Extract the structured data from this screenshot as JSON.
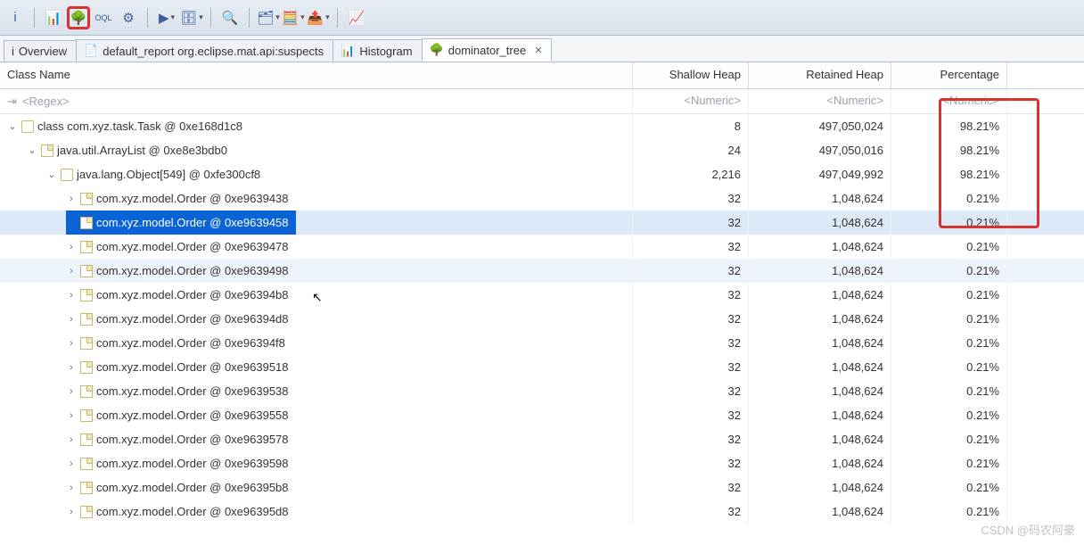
{
  "toolbar": {
    "items": [
      {
        "name": "info-icon",
        "glyph": "i",
        "drop": false
      },
      {
        "name": "sep"
      },
      {
        "name": "histogram-icon",
        "glyph": "📊",
        "drop": false
      },
      {
        "name": "dominator-tree-icon",
        "glyph": "🌳",
        "drop": false,
        "highlight": true
      },
      {
        "name": "oql-icon",
        "glyph": "OQL",
        "drop": false,
        "small": true
      },
      {
        "name": "gear-icon",
        "glyph": "⚙",
        "drop": false
      },
      {
        "name": "sep"
      },
      {
        "name": "run-icon",
        "glyph": "▶",
        "drop": true
      },
      {
        "name": "db-icon",
        "glyph": "🗄",
        "drop": true
      },
      {
        "name": "sep"
      },
      {
        "name": "search-icon",
        "glyph": "🔍",
        "drop": false
      },
      {
        "name": "sep"
      },
      {
        "name": "group-icon",
        "glyph": "🗂",
        "drop": true
      },
      {
        "name": "calc-icon",
        "glyph": "🧮",
        "drop": true
      },
      {
        "name": "export-icon",
        "glyph": "📤",
        "drop": true
      },
      {
        "name": "sep"
      },
      {
        "name": "chart-icon",
        "glyph": "📈",
        "drop": false
      }
    ]
  },
  "tabs": [
    {
      "icon": "i",
      "label": "Overview",
      "name": "tab-overview"
    },
    {
      "icon": "📄",
      "label": "default_report  org.eclipse.mat.api:suspects",
      "name": "tab-suspects"
    },
    {
      "icon": "📊",
      "label": "Histogram",
      "name": "tab-histogram"
    },
    {
      "icon": "🌳",
      "label": "dominator_tree",
      "name": "tab-dominator-tree",
      "active": true,
      "closable": true
    }
  ],
  "columns": {
    "c0": "Class Name",
    "c1": "Shallow Heap",
    "c2": "Retained Heap",
    "c3": "Percentage"
  },
  "filters": {
    "regex": "<Regex>",
    "numeric": "<Numeric>"
  },
  "rows": [
    {
      "depth": 0,
      "tw": "v",
      "icon": "class",
      "label": "class com.xyz.task.Task @ 0xe168d1c8",
      "sh": "8",
      "rh": "497,050,024",
      "pct": "98.21%"
    },
    {
      "depth": 1,
      "tw": "v",
      "icon": "file",
      "label": "java.util.ArrayList @ 0xe8e3bdb0",
      "sh": "24",
      "rh": "497,050,016",
      "pct": "98.21%"
    },
    {
      "depth": 2,
      "tw": "v",
      "icon": "class",
      "label": "java.lang.Object[549] @ 0xfe300cf8",
      "sh": "2,216",
      "rh": "497,049,992",
      "pct": "98.21%"
    },
    {
      "depth": 3,
      "tw": ">",
      "icon": "file",
      "label": "com.xyz.model.Order @ 0xe9639438",
      "sh": "32",
      "rh": "1,048,624",
      "pct": "0.21%"
    },
    {
      "depth": 3,
      "tw": ">",
      "icon": "file",
      "label": "com.xyz.model.Order @ 0xe9639458",
      "sh": "32",
      "rh": "1,048,624",
      "pct": "0.21%",
      "selected": true
    },
    {
      "depth": 3,
      "tw": ">",
      "icon": "file",
      "label": "com.xyz.model.Order @ 0xe9639478",
      "sh": "32",
      "rh": "1,048,624",
      "pct": "0.21%"
    },
    {
      "depth": 3,
      "tw": ">",
      "icon": "file",
      "label": "com.xyz.model.Order @ 0xe9639498",
      "sh": "32",
      "rh": "1,048,624",
      "pct": "0.21%",
      "stripe": true
    },
    {
      "depth": 3,
      "tw": ">",
      "icon": "file",
      "label": "com.xyz.model.Order @ 0xe96394b8",
      "sh": "32",
      "rh": "1,048,624",
      "pct": "0.21%"
    },
    {
      "depth": 3,
      "tw": ">",
      "icon": "file",
      "label": "com.xyz.model.Order @ 0xe96394d8",
      "sh": "32",
      "rh": "1,048,624",
      "pct": "0.21%"
    },
    {
      "depth": 3,
      "tw": ">",
      "icon": "file",
      "label": "com.xyz.model.Order @ 0xe96394f8",
      "sh": "32",
      "rh": "1,048,624",
      "pct": "0.21%"
    },
    {
      "depth": 3,
      "tw": ">",
      "icon": "file",
      "label": "com.xyz.model.Order @ 0xe9639518",
      "sh": "32",
      "rh": "1,048,624",
      "pct": "0.21%"
    },
    {
      "depth": 3,
      "tw": ">",
      "icon": "file",
      "label": "com.xyz.model.Order @ 0xe9639538",
      "sh": "32",
      "rh": "1,048,624",
      "pct": "0.21%"
    },
    {
      "depth": 3,
      "tw": ">",
      "icon": "file",
      "label": "com.xyz.model.Order @ 0xe9639558",
      "sh": "32",
      "rh": "1,048,624",
      "pct": "0.21%"
    },
    {
      "depth": 3,
      "tw": ">",
      "icon": "file",
      "label": "com.xyz.model.Order @ 0xe9639578",
      "sh": "32",
      "rh": "1,048,624",
      "pct": "0.21%"
    },
    {
      "depth": 3,
      "tw": ">",
      "icon": "file",
      "label": "com.xyz.model.Order @ 0xe9639598",
      "sh": "32",
      "rh": "1,048,624",
      "pct": "0.21%"
    },
    {
      "depth": 3,
      "tw": ">",
      "icon": "file",
      "label": "com.xyz.model.Order @ 0xe96395b8",
      "sh": "32",
      "rh": "1,048,624",
      "pct": "0.21%"
    },
    {
      "depth": 3,
      "tw": ">",
      "icon": "file",
      "label": "com.xyz.model.Order @ 0xe96395d8",
      "sh": "32",
      "rh": "1,048,624",
      "pct": "0.21%"
    }
  ],
  "watermark": "CSDN @码农阿豪"
}
